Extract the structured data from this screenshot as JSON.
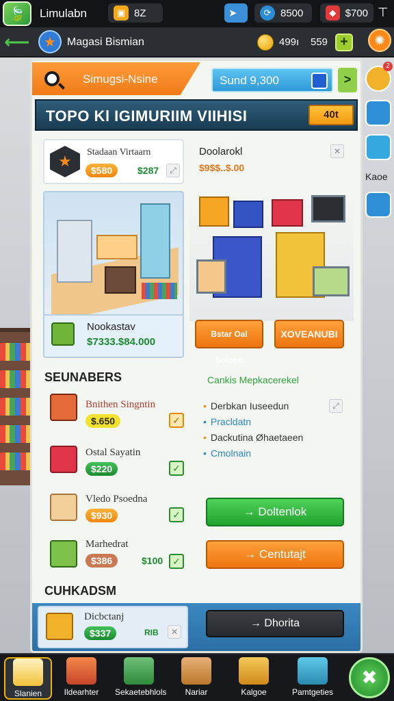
{
  "topbar": {
    "app_title": "Limulabn",
    "stat1": "8Z",
    "stat2": "8500",
    "stat3": "$700",
    "app_icon": "game-leaf-icon",
    "colors": {
      "bar": "#121518",
      "green": "#4fc34a",
      "orange": "#ff8a1a"
    }
  },
  "subbar": {
    "title": "Magasi Bismian",
    "coins": "499ı",
    "gems": "559",
    "plus": "+"
  },
  "search": {
    "label": "Simugsi-Nsine",
    "sound_value": "Sund 9,300",
    "go": ">"
  },
  "header": {
    "title": "TOPO Kl IGIMURIIM VIIHISI",
    "button": "40t"
  },
  "card_a": {
    "name": "Stadaan Virtaarn",
    "price": "$580",
    "value": "$287"
  },
  "card_b": {
    "title": "Doolarokl",
    "price": "$9$$..$.00"
  },
  "illus_left": {
    "name": "Nookastav",
    "value": "$7333.$84.000"
  },
  "action_buttons": {
    "left": "Bstar Oal Soloed",
    "right": "XOVEANUBI"
  },
  "sections": {
    "left_title": "SEUNABERS",
    "right_title": "Cankis Mepkacerekel",
    "bottom_title": "CUHKADSM"
  },
  "items": [
    {
      "name": "Bnithen Singntin",
      "price": "$.650",
      "check": "✓",
      "tag": "yellow"
    },
    {
      "name": "Ostal Sayatin",
      "price": "$220",
      "check": "✓",
      "tag": "green"
    },
    {
      "name": "Vledo Psoedna",
      "price": "$930",
      "check": "✓",
      "tag": "orange"
    },
    {
      "name": "Marhedrat",
      "price": "$386",
      "extra": "$100",
      "check": "✓",
      "tag": "brown"
    }
  ],
  "bullets": [
    "Derbkan Iuseedun",
    "Pracldatn",
    "Dackutina Øhaetaeen",
    "Cmolnain"
  ],
  "buttons": {
    "green": "→ Doltenlok",
    "orange": "→ Centutajt"
  },
  "footer": {
    "name": "Dicbctanj",
    "price": "$337",
    "small": "RIB",
    "dark_button": "→ Dhorita"
  },
  "rail": {
    "label": "Kaoe"
  },
  "nav": [
    {
      "label": "Slanien",
      "icon": "home-box-icon"
    },
    {
      "label": "Ildearhter",
      "icon": "shop-shelves-icon"
    },
    {
      "label": "Sekaetebhlols",
      "icon": "crate-icon"
    },
    {
      "label": "Nariar",
      "icon": "box-icon"
    },
    {
      "label": "Kalgoe",
      "icon": "goods-icon"
    },
    {
      "label": "Pamtgeties",
      "icon": "gift-icon"
    }
  ]
}
